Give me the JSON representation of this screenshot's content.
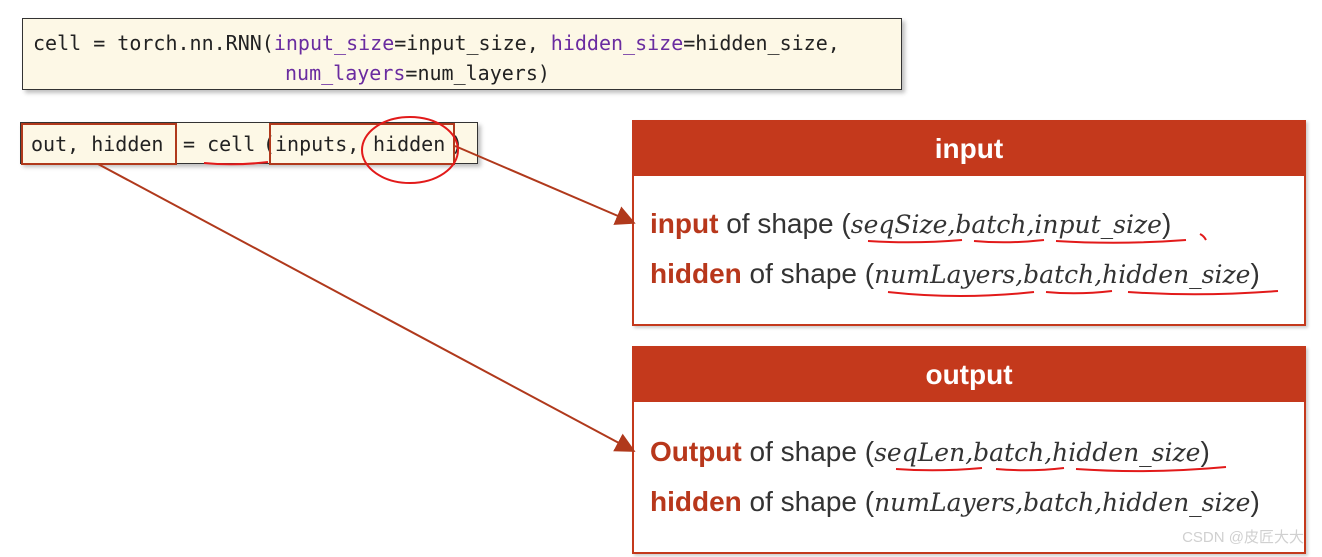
{
  "code1": {
    "line1_prefix": "cell = torch.nn.RNN(",
    "kw1": "input_size",
    "val1": "=input_size, ",
    "kw2": "hidden_size",
    "val2": "=hidden_size,",
    "kw3": "num_layers",
    "val3": "=num_layers)"
  },
  "code2": {
    "out_hidden": "out, hidden",
    "eq_cell": "= cell",
    "inputs": "inputs,",
    "hidden": "hidden",
    "paren_open": "(",
    "paren_close": ")"
  },
  "input_panel": {
    "title": "input",
    "row1": {
      "name": "input",
      "mid": " of shape (",
      "a": "seqSize",
      "b": "batch",
      "c": "input_size",
      "end": ")"
    },
    "row2": {
      "name": "hidden",
      "mid": " of shape (",
      "a": "numLayers",
      "b": "batch",
      "c": "hidden_size",
      "end": ")"
    }
  },
  "output_panel": {
    "title": "output",
    "row1": {
      "name": "Output",
      "mid": " of shape (",
      "a": "seqLen",
      "b": "batch",
      "c": "hidden_size",
      "end": ")"
    },
    "row2": {
      "name": "hidden",
      "mid": " of shape (",
      "a": "numLayers",
      "b": "batch",
      "c": "hidden_size",
      "end": ")"
    }
  },
  "comma": ",",
  "watermark": "CSDN @皮匠大大",
  "colors": {
    "accent": "#c4391c",
    "code_bg": "#fdf8e6",
    "keyword": "#6a2ca0"
  }
}
